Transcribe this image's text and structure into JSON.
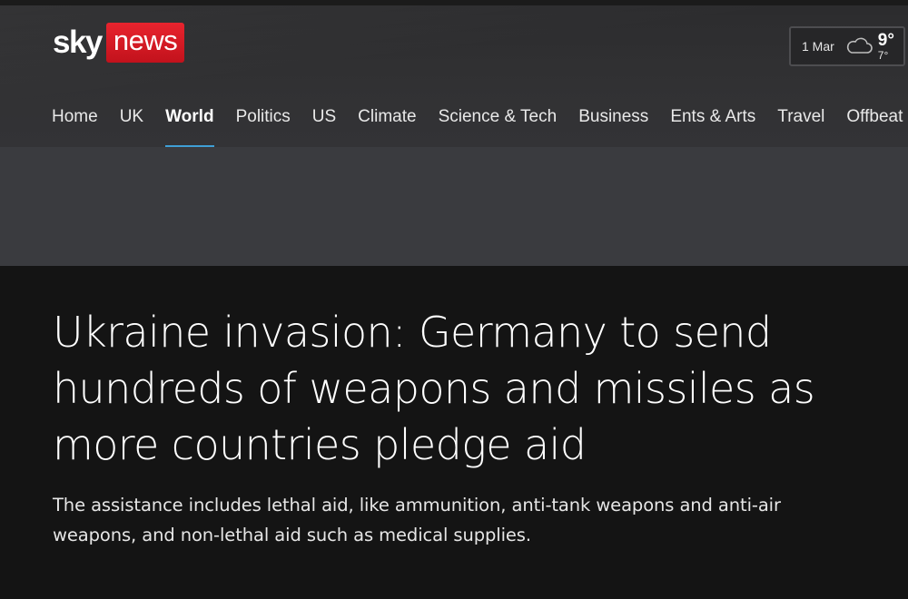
{
  "brand": {
    "logo_part1": "sky",
    "logo_part2": "news",
    "accent_color": "#d8161f"
  },
  "weather": {
    "date": "1 Mar",
    "icon": "cloud-icon",
    "high": "9°",
    "low": "7°"
  },
  "nav": {
    "active_color": "#3f9fd6",
    "items": [
      {
        "label": "Home"
      },
      {
        "label": "UK"
      },
      {
        "label": "World",
        "active": true
      },
      {
        "label": "Politics"
      },
      {
        "label": "US"
      },
      {
        "label": "Climate"
      },
      {
        "label": "Science & Tech"
      },
      {
        "label": "Business"
      },
      {
        "label": "Ents & Arts"
      },
      {
        "label": "Travel"
      },
      {
        "label": "Offbeat"
      }
    ]
  },
  "article": {
    "headline": "Ukraine invasion: Germany to send hundreds of weapons and missiles as more countries pledge aid",
    "standfirst": "The assistance includes lethal aid, like ammunition, anti-tank weapons and anti-air weapons, and non-lethal aid such as medical supplies."
  }
}
